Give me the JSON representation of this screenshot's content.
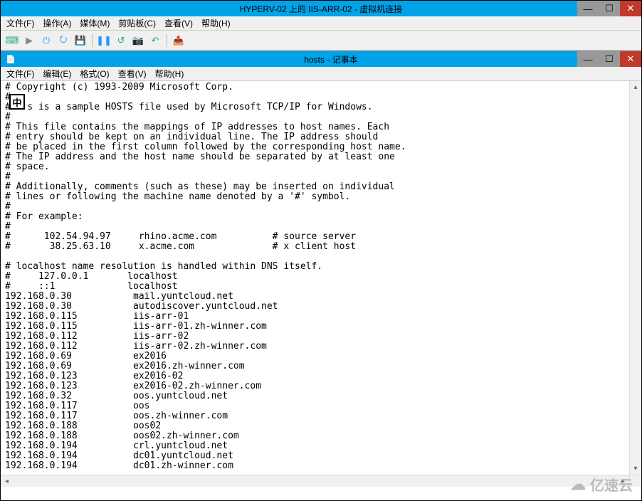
{
  "outer": {
    "title": "HYPERV-02 上的 IIS-ARR-02 - 虚拟机连接",
    "menus": {
      "file": "文件(F)",
      "action": "操作(A)",
      "media": "媒体(M)",
      "clipboard": "剪贴板(C)",
      "view": "查看(V)",
      "help": "帮助(H)"
    }
  },
  "inner": {
    "title": "hosts - 记事本",
    "menus": {
      "file": "文件(F)",
      "edit": "编辑(E)",
      "format": "格式(O)",
      "view": "查看(V)",
      "help": "帮助(H)"
    }
  },
  "ime": "中",
  "hosts_content": "# Copyright (c) 1993-2009 Microsoft Corp.\n#\n#   s is a sample HOSTS file used by Microsoft TCP/IP for Windows.\n#\n# This file contains the mappings of IP addresses to host names. Each\n# entry should be kept on an individual line. The IP address should\n# be placed in the first column followed by the corresponding host name.\n# The IP address and the host name should be separated by at least one\n# space.\n#\n# Additionally, comments (such as these) may be inserted on individual\n# lines or following the machine name denoted by a '#' symbol.\n#\n# For example:\n#\n#      102.54.94.97     rhino.acme.com          # source server\n#       38.25.63.10     x.acme.com              # x client host\n\n# localhost name resolution is handled within DNS itself.\n#     127.0.0.1       localhost\n#     ::1             localhost\n192.168.0.30           mail.yuntcloud.net\n192.168.0.30           autodiscover.yuntcloud.net\n192.168.0.115          iis-arr-01\n192.168.0.115          iis-arr-01.zh-winner.com\n192.168.0.112          iis-arr-02\n192.168.0.112          iis-arr-02.zh-winner.com\n192.168.0.69           ex2016\n192.168.0.69           ex2016.zh-winner.com\n192.168.0.123          ex2016-02\n192.168.0.123          ex2016-02.zh-winner.com\n192.168.0.32           oos.yuntcloud.net\n192.168.0.117          oos\n192.168.0.117          oos.zh-winner.com\n192.168.0.188          oos02\n192.168.0.188          oos02.zh-winner.com\n192.168.0.194          crl.yuntcloud.net\n192.168.0.194          dc01.yuntcloud.net\n192.168.0.194          dc01.zh-winner.com",
  "watermark": "亿速云"
}
